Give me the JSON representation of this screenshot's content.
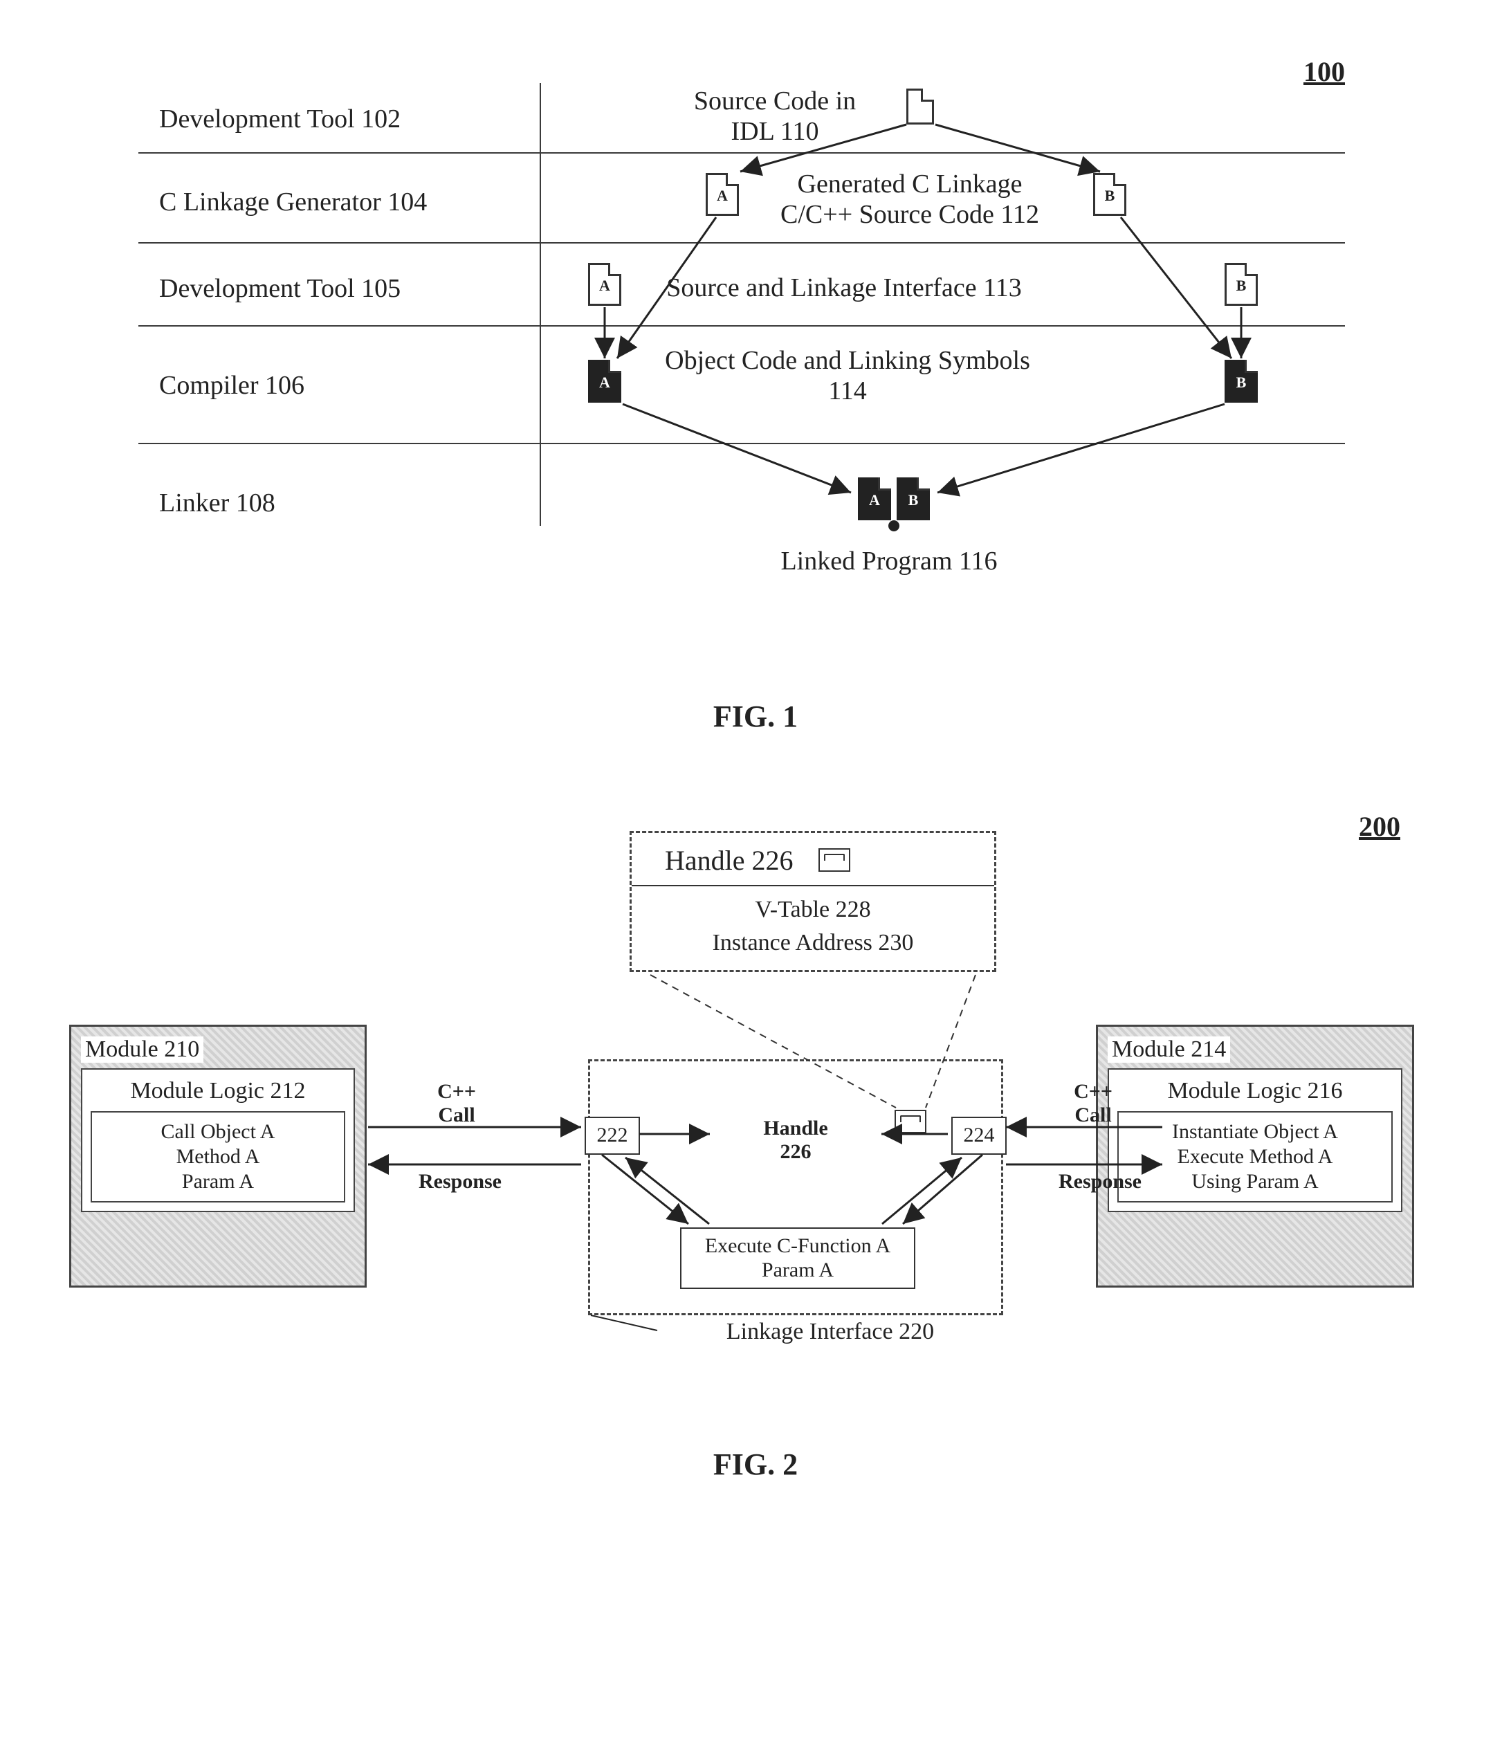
{
  "fig1": {
    "number": "100",
    "rows": {
      "r1": "Development Tool 102",
      "r2": "C Linkage Generator 104",
      "r3": "Development Tool 105",
      "r4": "Compiler 106",
      "r5": "Linker 108"
    },
    "headers": {
      "h1_t": "Source Code in",
      "h1_b": "IDL 110",
      "h2_t": "Generated C Linkage",
      "h2_b": "C/C++ Source Code 112",
      "h3": "Source and Linkage Interface 113",
      "h4_t": "Object Code and Linking Symbols",
      "h4_b": "114",
      "h5": "Linked Program 116"
    },
    "doc_labels": {
      "A": "A",
      "B": "B"
    },
    "caption": "FIG. 1"
  },
  "fig2": {
    "number": "200",
    "module_left": {
      "title": "Module 210",
      "logic_title": "Module Logic 212",
      "l1": "Call Object A",
      "l2": "Method A",
      "l3": "Param A"
    },
    "module_right": {
      "title": "Module 214",
      "logic_title": "Module Logic 216",
      "l1": "Instantiate Object A",
      "l2": "Execute Method A",
      "l3": "Using Param A"
    },
    "handle_box": {
      "title": "Handle 226",
      "line1": "V-Table 228",
      "line2": "Instance Address 230"
    },
    "linkage": {
      "left": "222",
      "right": "224",
      "handle_label_t": "Handle",
      "handle_label_b": "226",
      "cfn_t": "Execute C-Function A",
      "cfn_b": "Param A",
      "caption": "Linkage Interface 220"
    },
    "arrows": {
      "cpp_t": "C++",
      "cpp_b": "Call",
      "response": "Response"
    },
    "caption": "FIG. 2"
  }
}
